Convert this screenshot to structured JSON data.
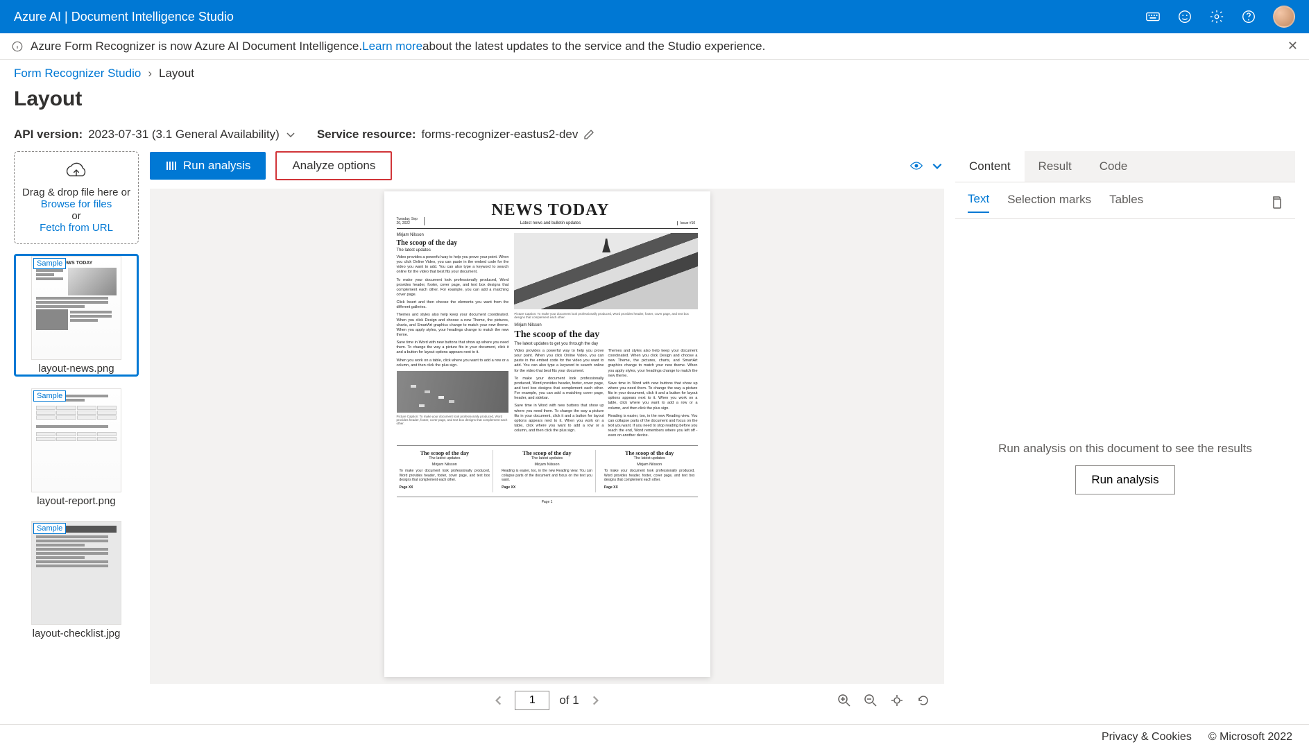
{
  "header": {
    "title": "Azure AI | Document Intelligence Studio"
  },
  "banner": {
    "text_prefix": "Azure Form Recognizer is now Azure AI Document Intelligence. ",
    "learn_more": "Learn more",
    "text_suffix": " about the latest updates to the service and the Studio experience."
  },
  "breadcrumb": {
    "root": "Form Recognizer Studio",
    "current": "Layout"
  },
  "page_title": "Layout",
  "settings": {
    "api_label": "API version:",
    "api_value": "2023-07-31 (3.1 General Availability)",
    "resource_label": "Service resource:",
    "resource_value": "forms-recognizer-eastus2-dev"
  },
  "dropzone": {
    "line1": "Drag & drop file here or",
    "browse": "Browse for files",
    "or": "or",
    "fetch": "Fetch from URL"
  },
  "thumbnails": [
    {
      "label": "layout-news.png",
      "sample": "Sample",
      "active": true
    },
    {
      "label": "layout-report.png",
      "sample": "Sample",
      "active": false
    },
    {
      "label": "layout-checklist.jpg",
      "sample": "Sample",
      "active": false
    }
  ],
  "toolbar": {
    "run": "Run analysis",
    "options": "Analyze options"
  },
  "document": {
    "masthead_date": "Tuesday, Sep 20, 2022",
    "masthead_title": "NEWS TODAY",
    "masthead_tag": "Latest news and bulletin updates",
    "masthead_issue": "Issue #10",
    "author": "Mirjam Nilsson",
    "headline": "The scoop of the day",
    "subhead": "The latest updates",
    "headline2": "The scoop of the day",
    "subhead2": "The latest updates to get you through the day",
    "col_head": "The scoop of the day",
    "col_sub": "The latest updates",
    "page_marker": "Page XX",
    "page_center": "Page 1"
  },
  "pager": {
    "page": "1",
    "of_text": "of 1"
  },
  "tabs": {
    "content": "Content",
    "result": "Result",
    "code": "Code"
  },
  "subtabs": {
    "text": "Text",
    "selection": "Selection marks",
    "tables": "Tables"
  },
  "results": {
    "empty_msg": "Run analysis on this document to see the results",
    "run_btn": "Run analysis"
  },
  "footer": {
    "privacy": "Privacy & Cookies",
    "copyright": "© Microsoft 2022"
  }
}
